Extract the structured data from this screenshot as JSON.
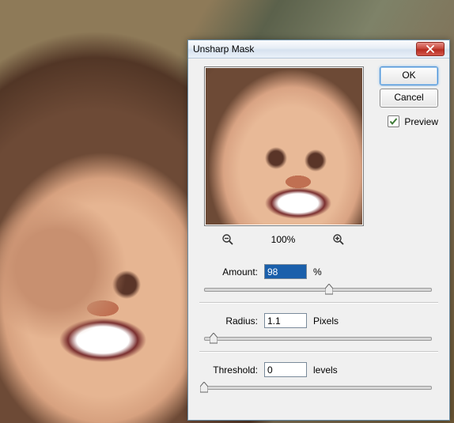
{
  "dialog": {
    "title": "Unsharp Mask",
    "ok_label": "OK",
    "cancel_label": "Cancel",
    "preview_label": "Preview",
    "preview_checked": true,
    "zoom_level": "100%"
  },
  "params": {
    "amount": {
      "label": "Amount:",
      "value": "98",
      "unit": "%",
      "slider_pct": 55
    },
    "radius": {
      "label": "Radius:",
      "value": "1.1",
      "unit": "Pixels",
      "slider_pct": 4
    },
    "threshold": {
      "label": "Threshold:",
      "value": "0",
      "unit": "levels",
      "slider_pct": 0
    }
  }
}
